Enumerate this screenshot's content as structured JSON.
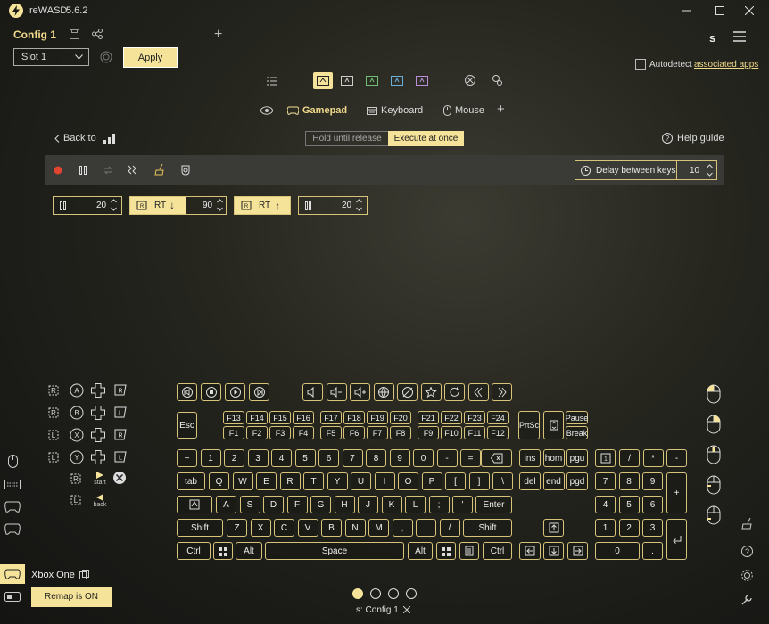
{
  "window": {
    "app_name": "reWASD",
    "version": "5.6.2",
    "controls": [
      "minimize",
      "maximize",
      "close"
    ]
  },
  "config": {
    "name": "Config 1",
    "add_label": "+",
    "slot": "Slot 1",
    "apply_label": "Apply",
    "profile_letter": "s",
    "autodetect_label": "Autodetect",
    "associated_apps_label": "associated apps"
  },
  "device_tabs": {
    "gamepad_label": "Gamepad",
    "keyboard_label": "Keyboard",
    "mouse_label": "Mouse",
    "add_label": "+"
  },
  "macro": {
    "back_label": "Back to",
    "mode_hold": "Hold until release",
    "mode_execute": "Execute at once",
    "help_label": "Help guide",
    "delay_label": "Delay between keys",
    "delay_value": "10",
    "sequence": [
      {
        "type": "pause",
        "value": "20"
      },
      {
        "type": "button",
        "label": "RT",
        "arrow": "↓",
        "value": "90"
      },
      {
        "type": "button",
        "label": "RT",
        "arrow": "↑"
      },
      {
        "type": "pause",
        "value": "20"
      }
    ]
  },
  "gamepad_side": {
    "start_label": "start",
    "back_label": "back"
  },
  "keyboard": {
    "fkeys_top": [
      "F13",
      "F14",
      "F15",
      "F16",
      "F17",
      "F18",
      "F19",
      "F20",
      "F21",
      "F22",
      "F23",
      "F24"
    ],
    "fkeys_bottom": [
      "F1",
      "F2",
      "F3",
      "F4",
      "F5",
      "F6",
      "F7",
      "F8",
      "F9",
      "F10",
      "F11",
      "F12"
    ],
    "esc": "Esc",
    "prtsc": "PrtSc",
    "pause": "Pause",
    "break": "Break",
    "num_row": [
      "~",
      "1",
      "2",
      "3",
      "4",
      "5",
      "6",
      "7",
      "8",
      "9",
      "0",
      "-",
      "="
    ],
    "q_row": [
      "tab",
      "Q",
      "W",
      "E",
      "R",
      "T",
      "Y",
      "U",
      "I",
      "O",
      "P",
      "[",
      "]",
      "\\"
    ],
    "a_row": [
      "A",
      "S",
      "D",
      "F",
      "G",
      "H",
      "J",
      "K",
      "L",
      ";",
      "'",
      "Enter"
    ],
    "z_row": [
      "Shift",
      "Z",
      "X",
      "C",
      "V",
      "B",
      "N",
      "M",
      ",",
      ".",
      "/",
      "Shift"
    ],
    "bottom_row": {
      "ctrl": "Ctrl",
      "alt": "Alt",
      "space": "Space"
    },
    "nav_top": [
      "ins",
      "hom",
      "pgu"
    ],
    "nav_bottom": [
      "del",
      "end",
      "pgd"
    ],
    "numpad": {
      "r1": [
        "/",
        "*",
        "-"
      ],
      "r2": [
        "7",
        "8",
        "9"
      ],
      "r3": [
        "4",
        "5",
        "6"
      ],
      "r4": [
        "1",
        "2",
        "3"
      ],
      "plus": "+",
      "zero": "0",
      "dot": "."
    }
  },
  "footer": {
    "device_name": "Xbox One",
    "remap_label": "Remap is ON",
    "profile_label": "s: Config 1",
    "page_dots": 4,
    "active_dot": 0
  },
  "colors": {
    "accent": "#f6e39a",
    "key_border": "#d8c37a",
    "record": "#e0452f"
  }
}
